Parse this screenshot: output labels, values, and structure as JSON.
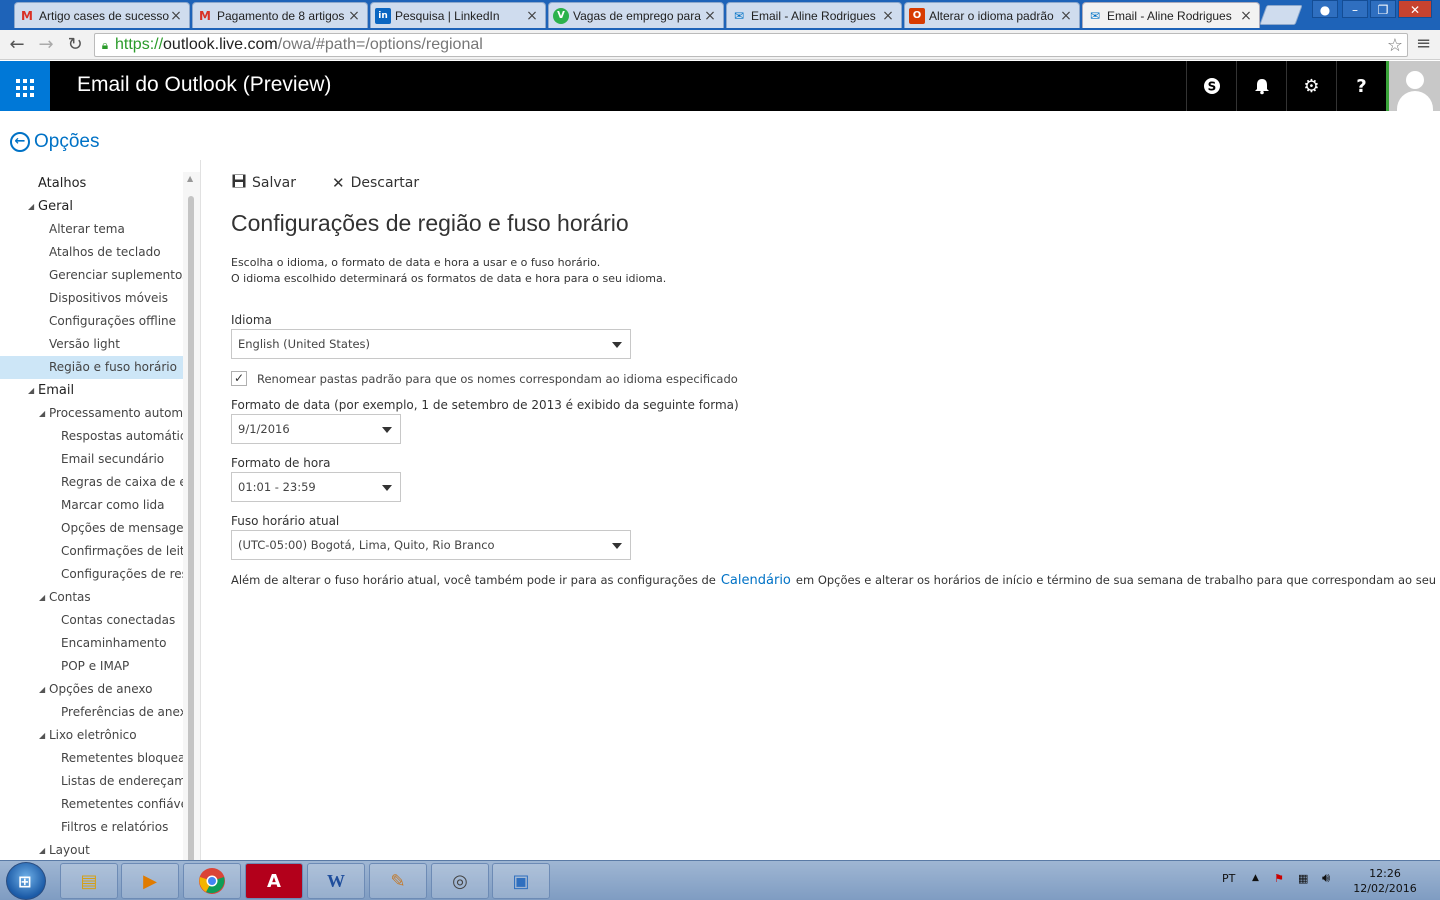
{
  "browser": {
    "tabs": [
      {
        "label": "Artigo cases de sucesso",
        "icon": "gmail-icon",
        "active": false
      },
      {
        "label": "Pagamento de 8 artigos",
        "icon": "gmail-icon",
        "active": false
      },
      {
        "label": "Pesquisa | LinkedIn",
        "icon": "linkedin-icon",
        "active": false
      },
      {
        "label": "Vagas de emprego para",
        "icon": "vagas-icon",
        "active": false
      },
      {
        "label": "Email - Aline Rodrigues",
        "icon": "outlook-mail-icon",
        "active": false
      },
      {
        "label": "Alterar o idioma padrão",
        "icon": "office-icon",
        "active": false
      },
      {
        "label": "Email - Aline Rodrigues",
        "icon": "outlook-mail-icon",
        "active": true
      }
    ],
    "url_scheme": "https://",
    "url_host": "outlook.live.com",
    "url_path": "/owa/#path=/options/regional"
  },
  "header": {
    "app_title": "Email do Outlook (Preview)",
    "buttons": [
      "skype-icon",
      "bell-icon",
      "gear-icon",
      "help-icon"
    ]
  },
  "options_back": "Opções",
  "sidebar": {
    "items": [
      {
        "label": "Atalhos",
        "level": 0,
        "expandable": false,
        "selected": false
      },
      {
        "label": "Geral",
        "level": 0,
        "expandable": true,
        "selected": false
      },
      {
        "label": "Alterar tema",
        "level": 1,
        "expandable": false,
        "selected": false
      },
      {
        "label": "Atalhos de teclado",
        "level": 1,
        "expandable": false,
        "selected": false
      },
      {
        "label": "Gerenciar suplementos",
        "level": 1,
        "expandable": false,
        "selected": false
      },
      {
        "label": "Dispositivos móveis",
        "level": 1,
        "expandable": false,
        "selected": false
      },
      {
        "label": "Configurações offline",
        "level": 1,
        "expandable": false,
        "selected": false
      },
      {
        "label": "Versão light",
        "level": 1,
        "expandable": false,
        "selected": false
      },
      {
        "label": "Região e fuso horário",
        "level": 1,
        "expandable": false,
        "selected": true
      },
      {
        "label": "Email",
        "level": 0,
        "expandable": true,
        "selected": false
      },
      {
        "label": "Processamento automático",
        "level": 1,
        "expandable": true,
        "selected": false
      },
      {
        "label": "Respostas automáticas",
        "level": 2,
        "expandable": false,
        "selected": false
      },
      {
        "label": "Email secundário",
        "level": 2,
        "expandable": false,
        "selected": false
      },
      {
        "label": "Regras de caixa de entrada",
        "level": 2,
        "expandable": false,
        "selected": false
      },
      {
        "label": "Marcar como lida",
        "level": 2,
        "expandable": false,
        "selected": false
      },
      {
        "label": "Opções de mensagem",
        "level": 2,
        "expandable": false,
        "selected": false
      },
      {
        "label": "Confirmações de leitura",
        "level": 2,
        "expandable": false,
        "selected": false
      },
      {
        "label": "Configurações de resposta",
        "level": 2,
        "expandable": false,
        "selected": false
      },
      {
        "label": "Contas",
        "level": 1,
        "expandable": true,
        "selected": false
      },
      {
        "label": "Contas conectadas",
        "level": 2,
        "expandable": false,
        "selected": false
      },
      {
        "label": "Encaminhamento",
        "level": 2,
        "expandable": false,
        "selected": false
      },
      {
        "label": "POP e IMAP",
        "level": 2,
        "expandable": false,
        "selected": false
      },
      {
        "label": "Opções de anexo",
        "level": 1,
        "expandable": true,
        "selected": false
      },
      {
        "label": "Preferências de anexo",
        "level": 2,
        "expandable": false,
        "selected": false
      },
      {
        "label": "Lixo eletrônico",
        "level": 1,
        "expandable": true,
        "selected": false
      },
      {
        "label": "Remetentes bloqueados",
        "level": 2,
        "expandable": false,
        "selected": false
      },
      {
        "label": "Listas de endereçamento",
        "level": 2,
        "expandable": false,
        "selected": false
      },
      {
        "label": "Remetentes confiáveis",
        "level": 2,
        "expandable": false,
        "selected": false
      },
      {
        "label": "Filtros e relatórios",
        "level": 2,
        "expandable": false,
        "selected": false
      },
      {
        "label": "Layout",
        "level": 1,
        "expandable": true,
        "selected": false
      }
    ]
  },
  "main": {
    "save_label": "Salvar",
    "discard_label": "Descartar",
    "title": "Configurações de região e fuso horário",
    "desc_line1": "Escolha o idioma, o formato de data e hora a usar e o fuso horário.",
    "desc_line2": "O idioma escolhido determinará os formatos de data e hora para o seu idioma.",
    "language_label": "Idioma",
    "language_value": "English (United States)",
    "rename_folders_checked": true,
    "rename_folders_label": "Renomear pastas padrão para que os nomes correspondam ao idioma especificado",
    "date_format_label": "Formato de data (por exemplo, 1 de setembro de 2013 é exibido da seguinte forma)",
    "date_format_value": "9/1/2016",
    "time_format_label": "Formato de hora",
    "time_format_value": "01:01 - 23:59",
    "timezone_label": "Fuso horário atual",
    "timezone_value": "(UTC-05:00) Bogotá, Lima, Quito, Rio Branco",
    "footnote_before": "Além de alterar o fuso horário atual, você também pode ir para as configurações de",
    "footnote_link": "Calendário",
    "footnote_after": "em Opções e alterar os horários de início e término de sua semana de trabalho para que correspondam ao seu fuso horário."
  },
  "taskbar": {
    "apps": [
      "file-explorer-icon",
      "media-player-icon",
      "chrome-icon",
      "acrobat-icon",
      "word-icon",
      "paint-icon",
      "search-app-icon",
      "screen-icon"
    ],
    "language": "PT",
    "time": "12:26",
    "date": "12/02/2016"
  }
}
